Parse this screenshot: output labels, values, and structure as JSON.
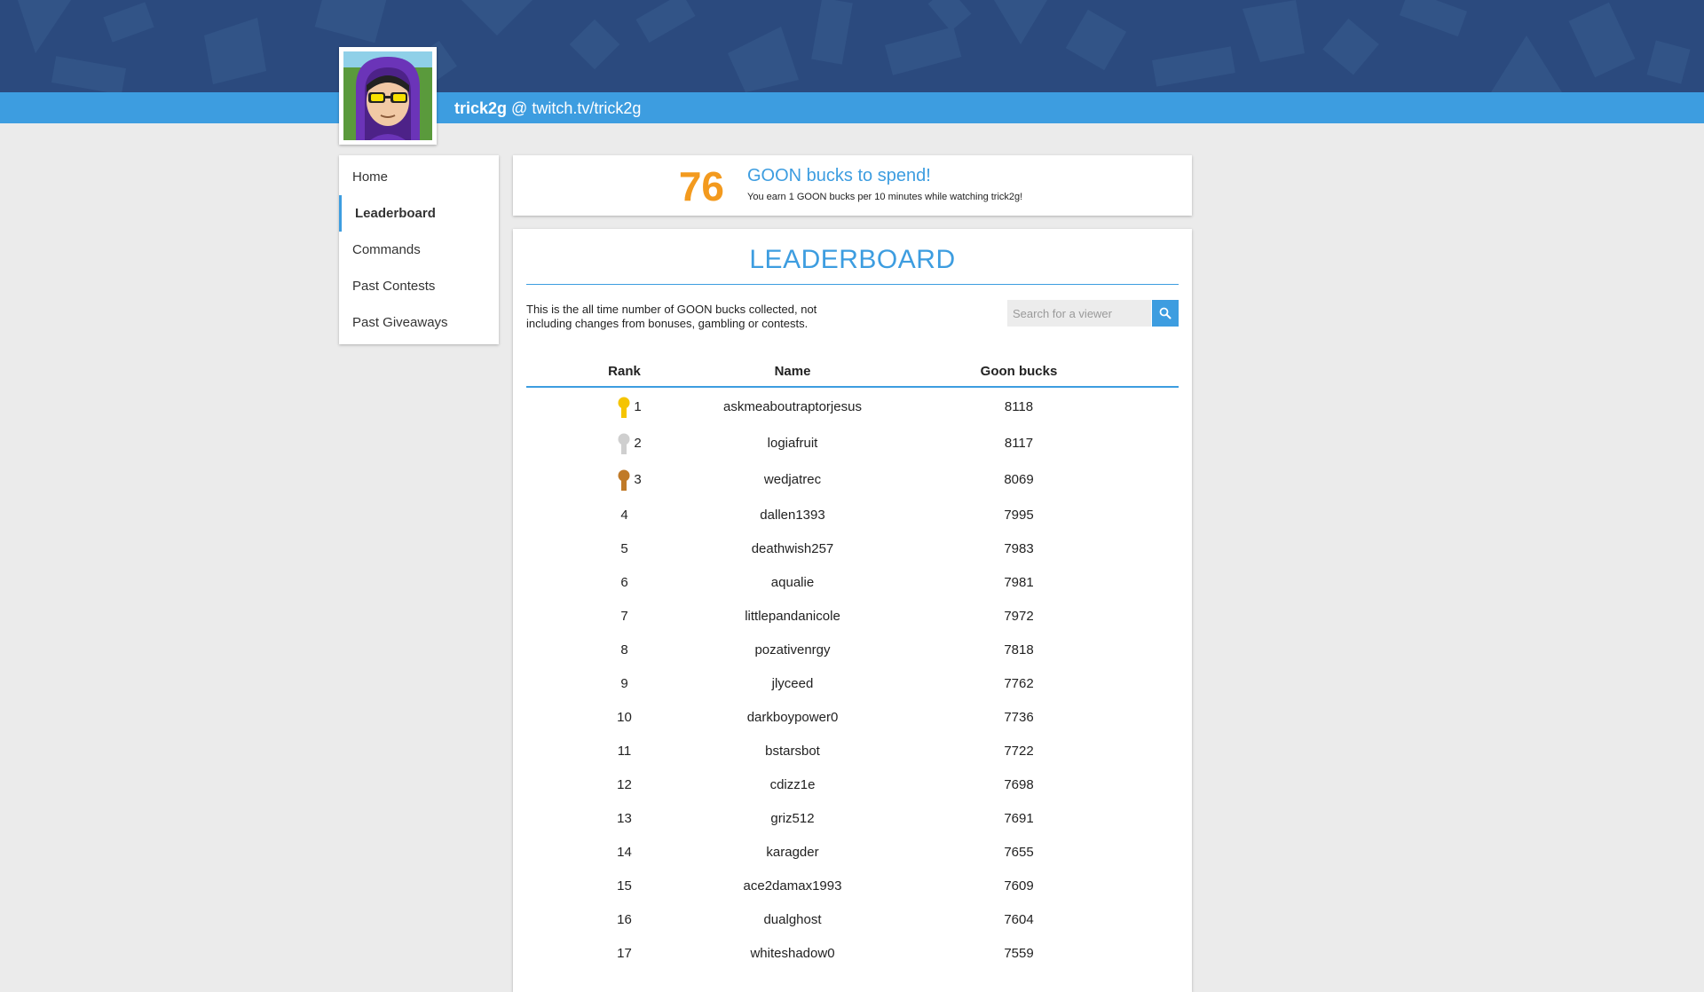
{
  "channel": {
    "username": "trick2g",
    "separator": "@",
    "url": "twitch.tv/trick2g"
  },
  "sidebar": {
    "items": [
      {
        "label": "Home",
        "active": false
      },
      {
        "label": "Leaderboard",
        "active": true
      },
      {
        "label": "Commands",
        "active": false
      },
      {
        "label": "Past Contests",
        "active": false
      },
      {
        "label": "Past Giveaways",
        "active": false
      }
    ]
  },
  "bucks": {
    "amount": "76",
    "title": "GOON bucks to spend!",
    "subtitle": "You earn 1 GOON bucks per 10 minutes while watching trick2g!"
  },
  "leaderboard": {
    "title": "LEADERBOARD",
    "description": "This is the all time number of GOON bucks collected, not including changes from bonuses, gambling or contests.",
    "search_placeholder": "Search for a viewer",
    "columns": {
      "rank": "Rank",
      "name": "Name",
      "bucks": "Goon bucks"
    },
    "rows": [
      {
        "rank": "1",
        "name": "askmeaboutraptorjesus",
        "bucks": "8118",
        "medal": "gold-medal-icon"
      },
      {
        "rank": "2",
        "name": "logiafruit",
        "bucks": "8117",
        "medal": "silver-medal-icon"
      },
      {
        "rank": "3",
        "name": "wedjatrec",
        "bucks": "8069",
        "medal": "bronze-medal-icon"
      },
      {
        "rank": "4",
        "name": "dallen1393",
        "bucks": "7995"
      },
      {
        "rank": "5",
        "name": "deathwish257",
        "bucks": "7983"
      },
      {
        "rank": "6",
        "name": "aqualie",
        "bucks": "7981"
      },
      {
        "rank": "7",
        "name": "littlepandanicole",
        "bucks": "7972"
      },
      {
        "rank": "8",
        "name": "pozativenrgy",
        "bucks": "7818"
      },
      {
        "rank": "9",
        "name": "jlyceed",
        "bucks": "7762"
      },
      {
        "rank": "10",
        "name": "darkboypower0",
        "bucks": "7736"
      },
      {
        "rank": "11",
        "name": "bstarsbot",
        "bucks": "7722"
      },
      {
        "rank": "12",
        "name": "cdizz1e",
        "bucks": "7698"
      },
      {
        "rank": "13",
        "name": "griz512",
        "bucks": "7691"
      },
      {
        "rank": "14",
        "name": "karagder",
        "bucks": "7655"
      },
      {
        "rank": "15",
        "name": "ace2damax1993",
        "bucks": "7609"
      },
      {
        "rank": "16",
        "name": "dualghost",
        "bucks": "7604"
      },
      {
        "rank": "17",
        "name": "whiteshadow0",
        "bucks": "7559"
      }
    ]
  },
  "colors": {
    "banner": "#2b4a7e",
    "accent": "#3d9de0",
    "bucks_amount": "#f39a1e",
    "gold": "#f5c400",
    "silver": "#cfcfcf",
    "bronze": "#c07a28"
  }
}
